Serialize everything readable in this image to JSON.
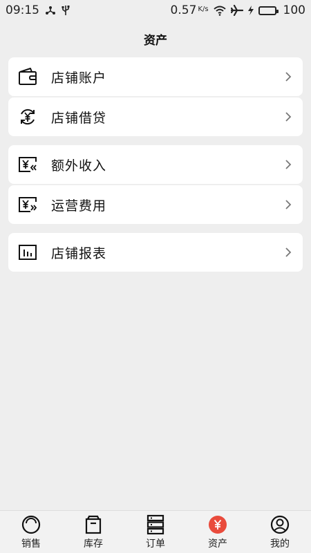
{
  "status_bar": {
    "time": "09:15",
    "speed_value": "0.57",
    "speed_unit": "K/s",
    "battery": "100",
    "icons": [
      "share-icon",
      "usb-icon",
      "wifi-icon",
      "airplane-icon",
      "charging-icon",
      "battery-icon"
    ]
  },
  "header": {
    "title": "资产"
  },
  "menu": {
    "items": [
      {
        "label": "店铺账户",
        "icon": "wallet-icon"
      },
      {
        "label": "店铺借贷",
        "icon": "loan-icon"
      },
      {
        "label": "额外收入",
        "icon": "income-icon"
      },
      {
        "label": "运营费用",
        "icon": "expense-icon"
      },
      {
        "label": "店铺报表",
        "icon": "report-icon"
      }
    ]
  },
  "tabs": {
    "items": [
      {
        "label": "销售",
        "icon": "sales-icon"
      },
      {
        "label": "库存",
        "icon": "inventory-icon"
      },
      {
        "label": "订单",
        "icon": "orders-icon"
      },
      {
        "label": "资产",
        "icon": "assets-icon",
        "active": true
      },
      {
        "label": "我的",
        "icon": "profile-icon"
      }
    ],
    "active_color": "#e94b3c"
  }
}
